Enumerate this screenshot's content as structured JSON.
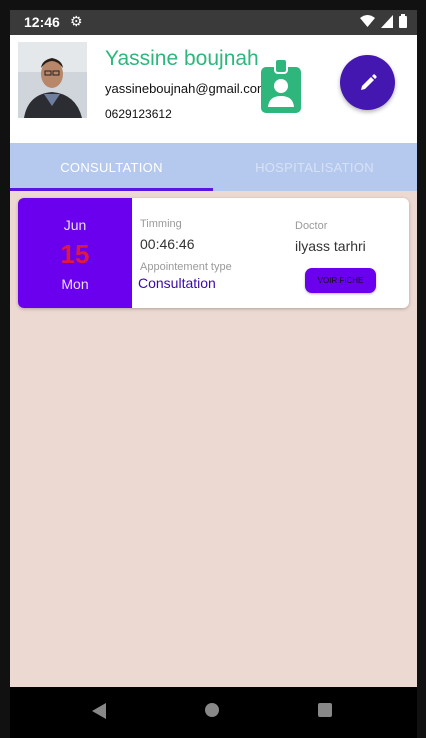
{
  "status_bar": {
    "time": "12:46",
    "settings_icon": "gear-icon",
    "icons": [
      "wifi-icon",
      "signal-icon",
      "battery-icon"
    ]
  },
  "profile": {
    "name": "Yassine boujnah",
    "email": "yassineboujnah@gmail.com",
    "phone": "0629123612",
    "badge_icon": "id-badge-icon",
    "edit_icon": "pencil-icon"
  },
  "tabs": [
    {
      "label": "CONSULTATION",
      "active": true
    },
    {
      "label": "HOSPITALISATION",
      "active": false
    }
  ],
  "appointment": {
    "month": "Jun",
    "day": "15",
    "weekday": "Mon",
    "timing_label": "Timming",
    "timing_value": "00:46:46",
    "type_label": "Appointement type",
    "type_value": "Consultation",
    "doctor_label": "Doctor",
    "doctor_value": "ilyass tarhri",
    "action_label": "VOIR FICHE"
  },
  "nav_bar": {
    "icons": [
      "back-icon",
      "home-icon",
      "recents-icon"
    ]
  },
  "colors": {
    "accent": "#6a00ee",
    "name": "#2eb67d",
    "tab_bar": "#b5c9ef",
    "background": "#ecd9d1",
    "date_day": "#e0193c"
  }
}
